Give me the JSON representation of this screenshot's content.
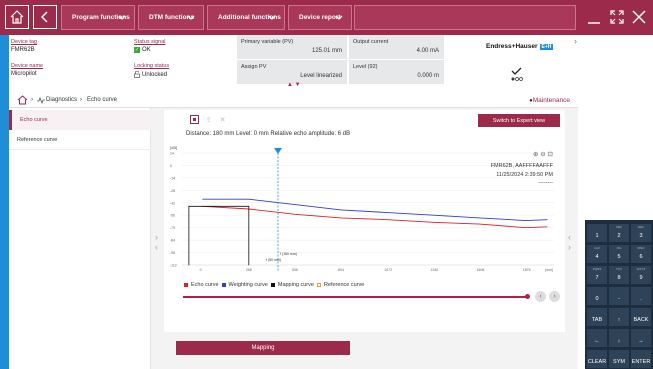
{
  "topbar": {
    "menus": [
      "Program functions",
      "DTM functions",
      "Additional functions",
      "Device report"
    ]
  },
  "header": {
    "device_tag_label": "Device tag",
    "device_tag_value": "FMR62B",
    "device_name_label": "Device name",
    "device_name_value": "Micropilot",
    "status_signal_label": "Status signal",
    "status_signal_value": "OK",
    "locking_status_label": "Locking status",
    "locking_status_value": "Unlocked",
    "primary_variable_label": "Primary variable (PV)",
    "primary_variable_value": "125.01 mm",
    "output_current_label": "Output current",
    "output_current_value": "4.00 mA",
    "assign_pv_label": "Assign PV",
    "assign_pv_value": "Level linearized",
    "level_label": "Level (92)",
    "level_value": "0.000 m",
    "logo_text": "Endress+Hauser",
    "logo_badge": "E+H"
  },
  "breadcrumb": {
    "diagnostics": "Diagnostics",
    "echo_curve": "Echo curve",
    "maintenance": "Maintenance"
  },
  "nav": {
    "items": [
      "Echo curve",
      "Reference curve"
    ]
  },
  "content": {
    "expert_button": "Switch to Expert view",
    "info_line": "Distance: 180 mm   Level: 0 mm   Relative echo amplitude: 6 dB",
    "plot_device": "FMR62B, AAFFFFAAFFF",
    "plot_datetime": "11/25/2024 2:39:50 PM",
    "plot_dashes": "--------",
    "mapping_button": "Mapping"
  },
  "chart_data": {
    "type": "line",
    "ylabel": "[dB]",
    "xlabel": "[mm]",
    "y_ticks": [
      "14",
      "0",
      "-14",
      "-28",
      "-42",
      "-56",
      "-70",
      "-84",
      "-98",
      "-112"
    ],
    "x_ticks": [
      "0",
      "268",
      "536",
      "804",
      "1072",
      "1340",
      "1608",
      "1876",
      "[mm]"
    ],
    "annotations": [
      "f (180 mm)",
      "f (50 mm)"
    ],
    "legend": [
      "Echo curve",
      "Weighting curve",
      "Mapping curve",
      "Reference curve"
    ],
    "series_colors": {
      "echo": "#e02020",
      "weighting": "#2a3fd4",
      "mapping": "#111111",
      "reference": "#f0a020"
    },
    "series": [
      {
        "name": "Echo curve",
        "x": [
          0,
          268,
          536,
          804,
          1072,
          1340,
          1608,
          1876,
          2000
        ],
        "y": [
          -46,
          -49,
          -55,
          -59,
          -61,
          -64,
          -66,
          -70,
          -69
        ]
      },
      {
        "name": "Weighting curve",
        "x": [
          0,
          268,
          536,
          804,
          1072,
          1340,
          1608,
          1876,
          2000
        ],
        "y": [
          -38,
          -38,
          -44,
          -50,
          -53,
          -56,
          -59,
          -62,
          -61
        ]
      },
      {
        "name": "Mapping curve",
        "x": [
          -80,
          -80,
          0,
          268,
          268
        ],
        "y": [
          -112,
          -46,
          -46,
          -46,
          -112
        ]
      }
    ],
    "ylim": [
      -112,
      14
    ],
    "xlim": [
      -120,
      2040
    ]
  },
  "keypad": {
    "keys": [
      {
        "main": "1",
        "sub": ""
      },
      {
        "main": "2",
        "sub": "ABC"
      },
      {
        "main": "3",
        "sub": "DEF"
      },
      {
        "main": "4",
        "sub": "GHI"
      },
      {
        "main": "5",
        "sub": "JKL"
      },
      {
        "main": "6",
        "sub": "MNO"
      },
      {
        "main": "7",
        "sub": "PQRS"
      },
      {
        "main": "8",
        "sub": "TUV"
      },
      {
        "main": "9",
        "sub": "WXYZ"
      },
      {
        "main": "0",
        "sub": ""
      },
      {
        "main": "-",
        "sub": ""
      },
      {
        "main": ".",
        "sub": ""
      },
      {
        "main": "TAB",
        "sub": ""
      },
      {
        "main": "↑",
        "sub": ""
      },
      {
        "main": "BACK",
        "sub": ""
      },
      {
        "main": "←",
        "sub": ""
      },
      {
        "main": "↓",
        "sub": ""
      },
      {
        "main": "→",
        "sub": ""
      },
      {
        "main": "CLEAR",
        "sub": ""
      },
      {
        "main": "SYM",
        "sub": ""
      },
      {
        "main": "ENTER",
        "sub": ""
      }
    ]
  }
}
